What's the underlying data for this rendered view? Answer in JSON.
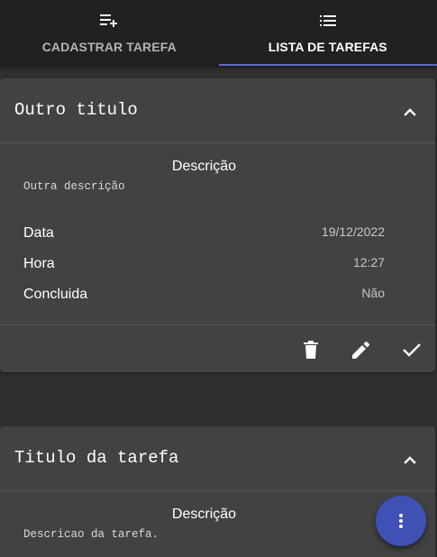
{
  "tabs": [
    {
      "label": "CADASTRAR TAREFA",
      "icon": "playlist-add-icon",
      "active": false
    },
    {
      "label": "LISTA DE TAREFAS",
      "icon": "list-icon",
      "active": true
    }
  ],
  "tasks": [
    {
      "title": "Outro titulo",
      "description_label": "Descrição",
      "description": "Outra descrição",
      "fields": [
        {
          "key": "Data",
          "value": "19/12/2022"
        },
        {
          "key": "Hora",
          "value": "12:27"
        },
        {
          "key": "Concluida",
          "value": "Não"
        }
      ],
      "expanded": true,
      "actions": [
        "delete-icon",
        "edit-icon",
        "check-icon"
      ]
    },
    {
      "title": "Titulo da tarefa",
      "description_label": "Descrição",
      "description": "Descricao da tarefa.",
      "expanded": true
    }
  ],
  "colors": {
    "background": "#303030",
    "card": "#424242",
    "tabbar": "#212121",
    "accent": "#3f51b5",
    "indicator": "#5c6bc0"
  },
  "fab": {
    "icon": "more-vert-icon"
  }
}
